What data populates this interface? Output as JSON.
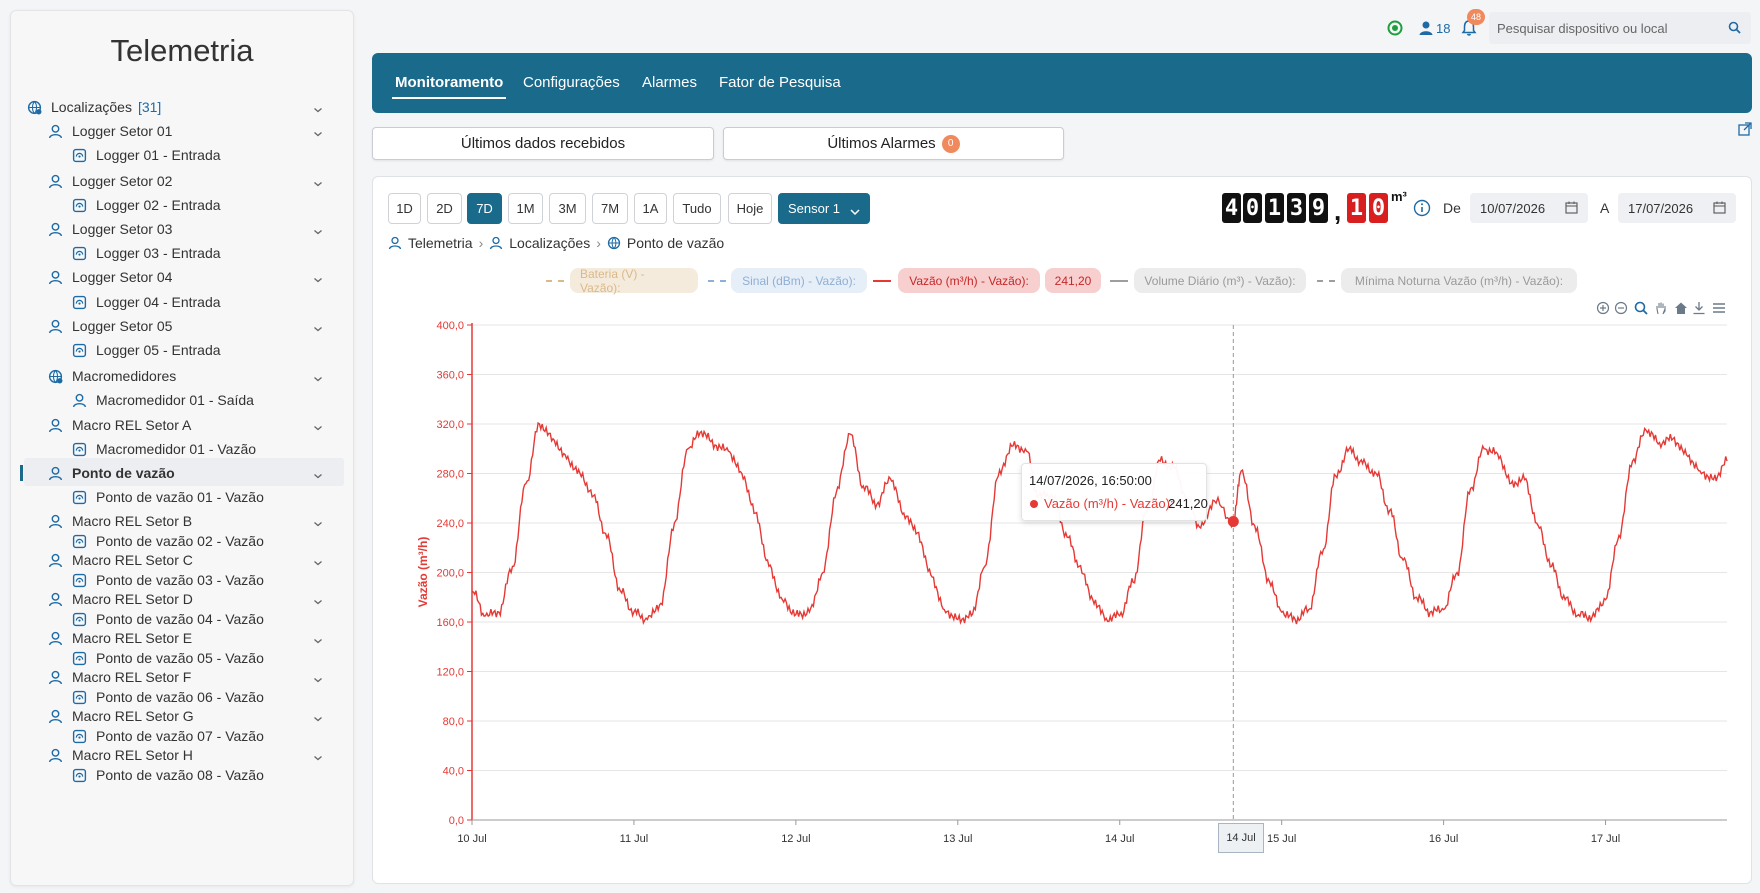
{
  "app_title": "Telemetria",
  "sidebar": {
    "root": {
      "label": "Localizações",
      "count": "[31]"
    },
    "items": [
      {
        "label": "Logger Setor 01",
        "level": 1,
        "type": "group"
      },
      {
        "label": "Logger 01 - Entrada",
        "level": 2,
        "type": "device"
      },
      {
        "label": "Logger Setor 02",
        "level": 1,
        "type": "group"
      },
      {
        "label": "Logger 02 - Entrada",
        "level": 2,
        "type": "device"
      },
      {
        "label": "Logger Setor 03",
        "level": 1,
        "type": "group"
      },
      {
        "label": "Logger 03 - Entrada",
        "level": 2,
        "type": "device"
      },
      {
        "label": "Logger Setor 04",
        "level": 1,
        "type": "group"
      },
      {
        "label": "Logger 04 - Entrada",
        "level": 2,
        "type": "device"
      },
      {
        "label": "Logger Setor 05",
        "level": 1,
        "type": "group"
      },
      {
        "label": "Logger 05 - Entrada",
        "level": 2,
        "type": "device"
      },
      {
        "label": "Macromedidores",
        "level": 1,
        "type": "location"
      },
      {
        "label": "Macromedidor 01 - Saída",
        "level": 2,
        "type": "user"
      },
      {
        "label": "Macro REL Setor A",
        "level": 1,
        "type": "group"
      },
      {
        "label": "Macromedidor 01 - Vazão",
        "level": 2,
        "type": "device"
      },
      {
        "label": "Ponto de vazão",
        "level": 1,
        "type": "group",
        "active": true
      },
      {
        "label": "Ponto de vazão 01 - Vazão",
        "level": 2,
        "type": "device"
      },
      {
        "label": "Macro REL Setor B",
        "level": 1,
        "type": "group"
      },
      {
        "label": "Ponto de vazão 02 - Vazão",
        "level": 2,
        "type": "device"
      },
      {
        "label": "Macro REL Setor C",
        "level": 1,
        "type": "group"
      },
      {
        "label": "Ponto de vazão 03 - Vazão",
        "level": 2,
        "type": "device"
      },
      {
        "label": "Macro REL Setor D",
        "level": 1,
        "type": "group"
      },
      {
        "label": "Ponto de vazão 04 - Vazão",
        "level": 2,
        "type": "device"
      },
      {
        "label": "Macro REL Setor E",
        "level": 1,
        "type": "group"
      },
      {
        "label": "Ponto de vazão 05 - Vazão",
        "level": 2,
        "type": "device"
      },
      {
        "label": "Macro REL Setor F",
        "level": 1,
        "type": "group"
      },
      {
        "label": "Ponto de vazão 06 - Vazão",
        "level": 2,
        "type": "device"
      },
      {
        "label": "Macro REL Setor G",
        "level": 1,
        "type": "group"
      },
      {
        "label": "Ponto de vazão 07 - Vazão",
        "level": 2,
        "type": "device"
      },
      {
        "label": "Macro REL Setor H",
        "level": 1,
        "type": "group"
      },
      {
        "label": "Ponto de vazão 08 - Vazão",
        "level": 2,
        "type": "device"
      }
    ]
  },
  "topbar": {
    "users_count": "18",
    "notifications_count": "48",
    "search_placeholder": "Pesquisar dispositivo ou local"
  },
  "tabs": [
    "Monitoramento",
    "Configurações",
    "Alarmes",
    "Fator de Pesquisa"
  ],
  "subtabs": {
    "last_data": "Últimos dados recebidos",
    "last_alarms": "Últimos Alarmes",
    "alarms_count": "0"
  },
  "ranges": [
    "1D",
    "2D",
    "7D",
    "1M",
    "3M",
    "7M",
    "1A",
    "Tudo",
    "Hoje"
  ],
  "active_range": "7D",
  "sensor_label": "Sensor 1",
  "meter": {
    "integer_digits": [
      "4",
      "0",
      "1",
      "3",
      "9"
    ],
    "decimal_digits": [
      "1",
      "0"
    ],
    "separator": ",",
    "unit": "m³"
  },
  "date_filter": {
    "from_label": "De",
    "from": "10/07/2026",
    "to_label": "A",
    "to": "17/07/2026"
  },
  "breadcrumb": [
    "Telemetria",
    "Localizações",
    "Ponto de vazão"
  ],
  "legend": [
    {
      "name": "Bateria (V) - Vazão):",
      "value": "",
      "color": "#d9b98a",
      "bg": "#f5ebdd",
      "state": "hidden"
    },
    {
      "name": "Sinal (dBm) - Vazão):",
      "value": "",
      "color": "#8fb0d6",
      "bg": "#e6eef8",
      "state": "hidden"
    },
    {
      "name": "Vazão (m³/h) - Vazão):",
      "value": "241,20",
      "color": "#e53935",
      "bg": "#f8cfcf",
      "state": "active"
    },
    {
      "name": "Volume Diário (m³) - Vazão):",
      "value": "",
      "color": "#9e9e9e",
      "bg": "#ececec",
      "state": "hidden"
    },
    {
      "name": "Mínima Noturna Vazão (m³/h) - Vazão):",
      "value": "",
      "color": "#9e9e9e",
      "bg": "#ececec",
      "state": "hidden"
    }
  ],
  "tooltip": {
    "title": "14/07/2026, 16:50:00",
    "series": "Vazão (m³/h) - Vazão):",
    "value": "241,20"
  },
  "crosshair_label": "14 Jul",
  "colors": {
    "primary": "#1a6a8c",
    "series": "#e53935",
    "badge": "#f08a5d"
  },
  "chart_data": {
    "type": "line",
    "ylabel": "Vazão (m³/h)",
    "ylim": [
      0,
      400
    ],
    "yticks": [
      "0,0",
      "40,0",
      "80,0",
      "120,0",
      "160,0",
      "200,0",
      "240,0",
      "280,0",
      "320,0",
      "360,0",
      "400,0"
    ],
    "xlim": [
      "2026-07-10 00:00",
      "2026-07-17 18:00"
    ],
    "xticks": [
      {
        "label": "10 Jul",
        "t": "2026-07-10 00:00"
      },
      {
        "label": "11 Jul",
        "t": "2026-07-11 00:00"
      },
      {
        "label": "12 Jul",
        "t": "2026-07-12 00:00"
      },
      {
        "label": "13 Jul",
        "t": "2026-07-13 00:00"
      },
      {
        "label": "14 Jul",
        "t": "2026-07-14 00:00"
      },
      {
        "label": "15 Jul",
        "t": "2026-07-15 00:00"
      },
      {
        "label": "16 Jul",
        "t": "2026-07-16 00:00"
      },
      {
        "label": "17 Jul",
        "t": "2026-07-17 00:00"
      }
    ],
    "highlight": {
      "t": "2026-07-14 16:50",
      "y": 241.2
    },
    "series": [
      {
        "name": "Vazão (m³/h) - Vazão):",
        "color": "#e53935",
        "points": [
          [
            "2026-07-10 00:00",
            185
          ],
          [
            "2026-07-10 02:00",
            165
          ],
          [
            "2026-07-10 04:00",
            168
          ],
          [
            "2026-07-10 06:00",
            205
          ],
          [
            "2026-07-10 08:00",
            272
          ],
          [
            "2026-07-10 10:00",
            320
          ],
          [
            "2026-07-10 12:00",
            308
          ],
          [
            "2026-07-10 14:00",
            292
          ],
          [
            "2026-07-10 16:00",
            280
          ],
          [
            "2026-07-10 18:00",
            262
          ],
          [
            "2026-07-10 20:00",
            228
          ],
          [
            "2026-07-10 22:00",
            185
          ],
          [
            "2026-07-11 00:00",
            168
          ],
          [
            "2026-07-11 02:00",
            162
          ],
          [
            "2026-07-11 04:00",
            175
          ],
          [
            "2026-07-11 06:00",
            240
          ],
          [
            "2026-07-11 08:00",
            300
          ],
          [
            "2026-07-11 10:00",
            314
          ],
          [
            "2026-07-11 12:00",
            303
          ],
          [
            "2026-07-11 14:00",
            298
          ],
          [
            "2026-07-11 16:00",
            280
          ],
          [
            "2026-07-11 18:00",
            248
          ],
          [
            "2026-07-11 20:00",
            205
          ],
          [
            "2026-07-11 22:00",
            178
          ],
          [
            "2026-07-12 00:00",
            166
          ],
          [
            "2026-07-12 02:00",
            168
          ],
          [
            "2026-07-12 04:00",
            200
          ],
          [
            "2026-07-12 06:00",
            265
          ],
          [
            "2026-07-12 08:00",
            312
          ],
          [
            "2026-07-12 10:00",
            270
          ],
          [
            "2026-07-12 12:00",
            255
          ],
          [
            "2026-07-12 14:00",
            276
          ],
          [
            "2026-07-12 16:00",
            248
          ],
          [
            "2026-07-12 18:00",
            232
          ],
          [
            "2026-07-12 20:00",
            198
          ],
          [
            "2026-07-12 22:00",
            170
          ],
          [
            "2026-07-13 00:00",
            162
          ],
          [
            "2026-07-13 02:00",
            165
          ],
          [
            "2026-07-13 04:00",
            205
          ],
          [
            "2026-07-13 06:00",
            278
          ],
          [
            "2026-07-13 08:00",
            302
          ],
          [
            "2026-07-13 10:00",
            300
          ],
          [
            "2026-07-13 12:00",
            262
          ],
          [
            "2026-07-13 14:00",
            262
          ],
          [
            "2026-07-13 16:00",
            232
          ],
          [
            "2026-07-13 18:00",
            205
          ],
          [
            "2026-07-13 20:00",
            178
          ],
          [
            "2026-07-13 22:00",
            163
          ],
          [
            "2026-07-14 00:00",
            165
          ],
          [
            "2026-07-14 02:00",
            192
          ],
          [
            "2026-07-14 04:00",
            250
          ],
          [
            "2026-07-14 06:00",
            290
          ],
          [
            "2026-07-14 08:00",
            285
          ],
          [
            "2026-07-14 10:00",
            260
          ],
          [
            "2026-07-14 12:00",
            236
          ],
          [
            "2026-07-14 14:00",
            258
          ],
          [
            "2026-07-14 16:50",
            241
          ],
          [
            "2026-07-14 18:00",
            282
          ],
          [
            "2026-07-14 20:00",
            238
          ],
          [
            "2026-07-14 22:00",
            195
          ],
          [
            "2026-07-15 00:00",
            168
          ],
          [
            "2026-07-15 02:00",
            162
          ],
          [
            "2026-07-15 04:00",
            170
          ],
          [
            "2026-07-15 06:00",
            215
          ],
          [
            "2026-07-15 08:00",
            278
          ],
          [
            "2026-07-15 10:00",
            300
          ],
          [
            "2026-07-15 12:00",
            288
          ],
          [
            "2026-07-15 14:00",
            280
          ],
          [
            "2026-07-15 16:00",
            250
          ],
          [
            "2026-07-15 18:00",
            210
          ],
          [
            "2026-07-15 20:00",
            180
          ],
          [
            "2026-07-15 22:00",
            168
          ],
          [
            "2026-07-16 00:00",
            170
          ],
          [
            "2026-07-16 02:00",
            200
          ],
          [
            "2026-07-16 04:00",
            268
          ],
          [
            "2026-07-16 06:00",
            300
          ],
          [
            "2026-07-16 08:00",
            296
          ],
          [
            "2026-07-16 10:00",
            272
          ],
          [
            "2026-07-16 12:00",
            275
          ],
          [
            "2026-07-16 14:00",
            238
          ],
          [
            "2026-07-16 16:00",
            205
          ],
          [
            "2026-07-16 18:00",
            178
          ],
          [
            "2026-07-16 20:00",
            166
          ],
          [
            "2026-07-16 22:00",
            164
          ],
          [
            "2026-07-17 00:00",
            178
          ],
          [
            "2026-07-17 02:00",
            230
          ],
          [
            "2026-07-17 04:00",
            290
          ],
          [
            "2026-07-17 06:00",
            315
          ],
          [
            "2026-07-17 08:00",
            305
          ],
          [
            "2026-07-17 10:00",
            308
          ],
          [
            "2026-07-17 12:00",
            295
          ],
          [
            "2026-07-17 14:00",
            282
          ],
          [
            "2026-07-17 16:00",
            275
          ],
          [
            "2026-07-17 18:00",
            290
          ]
        ]
      }
    ]
  }
}
